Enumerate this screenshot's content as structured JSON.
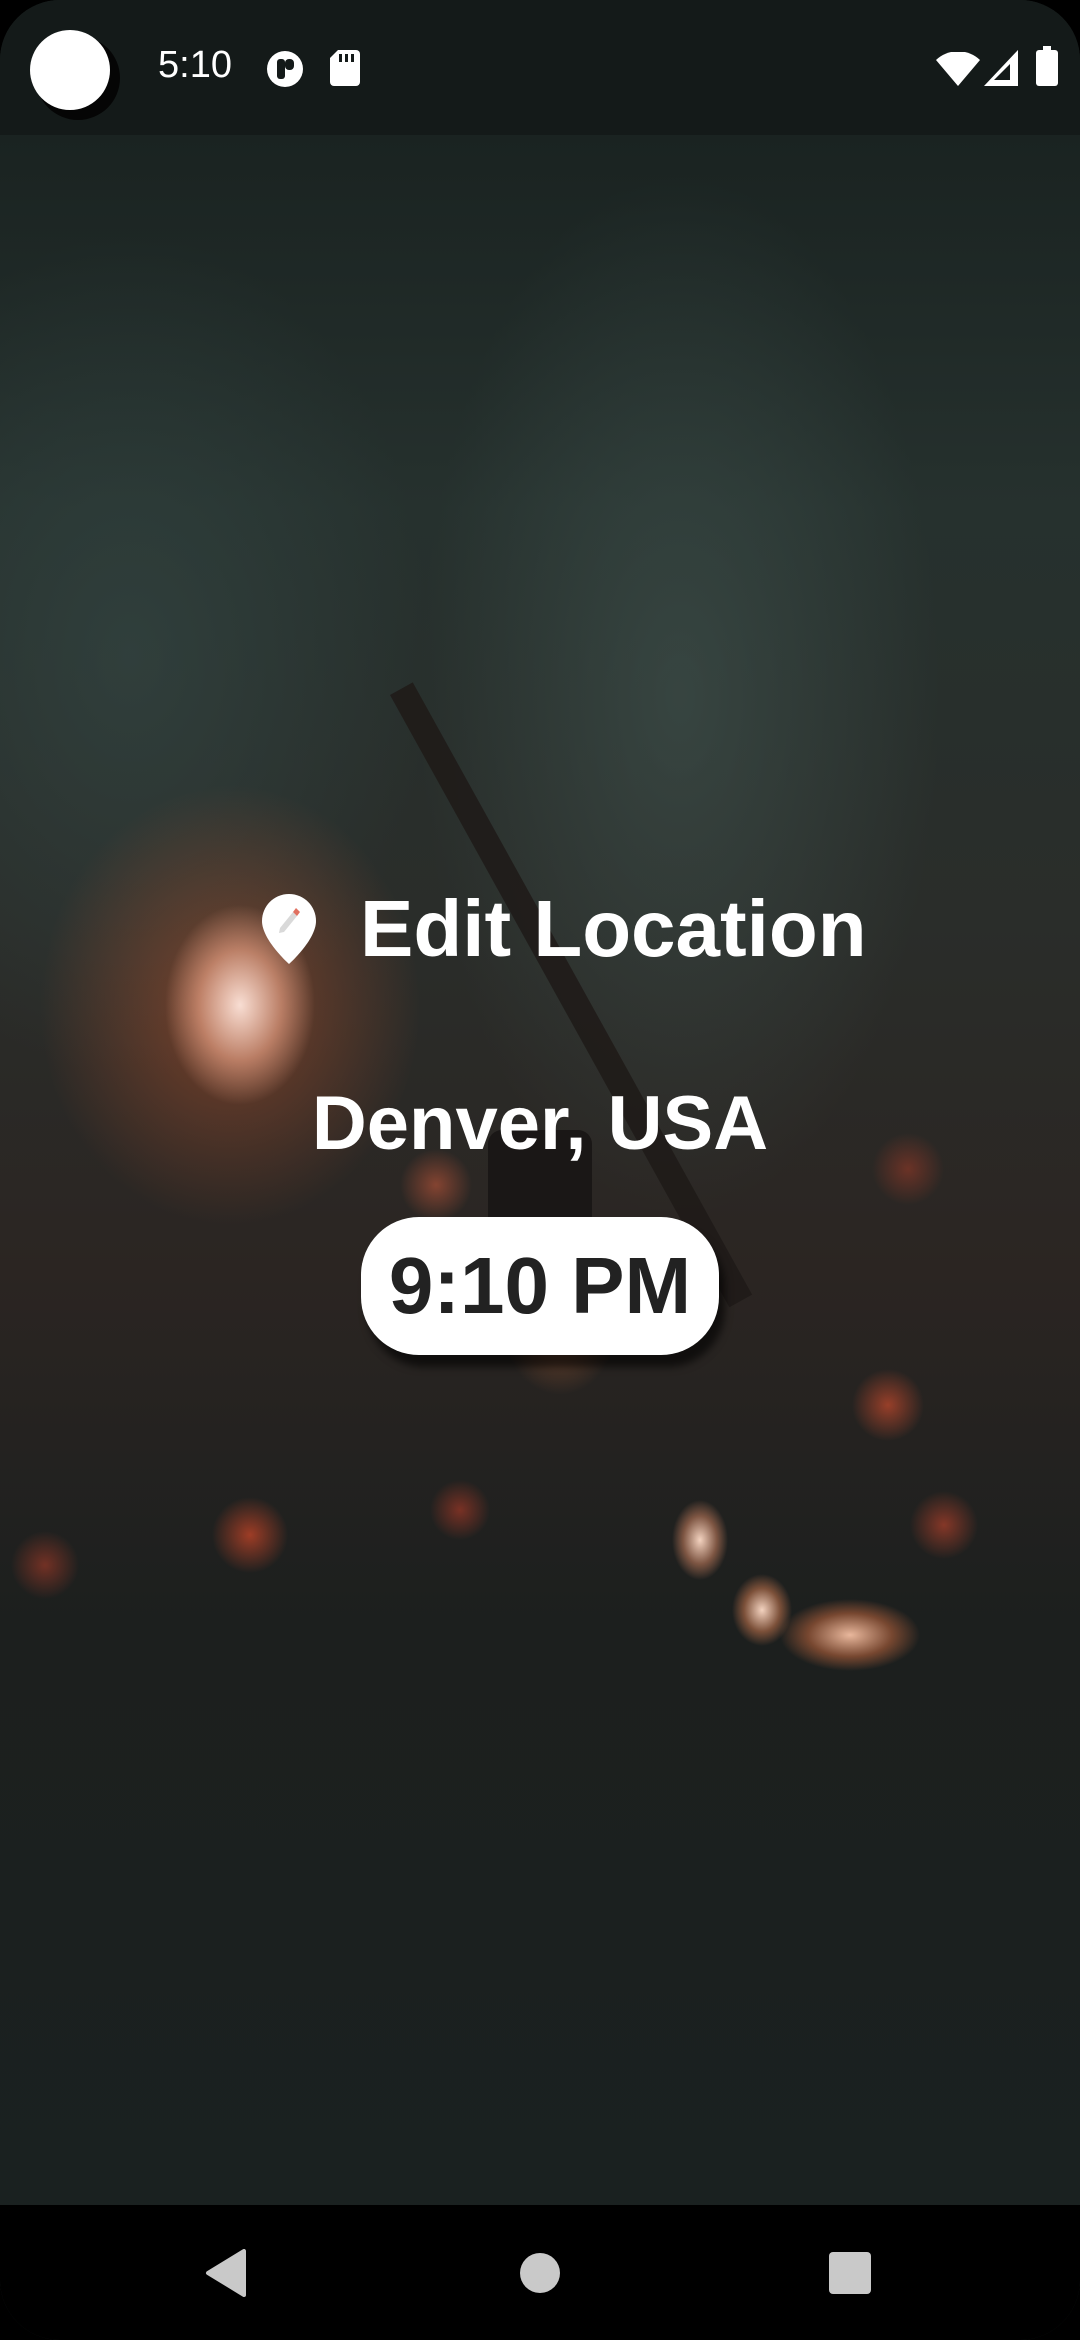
{
  "status_bar": {
    "time": "5:10",
    "left_icons": [
      "app-notification-icon",
      "sd-card-icon"
    ],
    "right_icons": [
      "wifi-icon",
      "cell-signal-icon",
      "battery-icon"
    ]
  },
  "main": {
    "edit_location_label": "Edit Location",
    "location_name": "Denver, USA",
    "time": "9:10 PM"
  },
  "nav_bar": {
    "buttons": [
      "back-icon",
      "home-icon",
      "recents-icon"
    ]
  },
  "colors": {
    "text": "#ffffff",
    "pill_background": "#ffffff",
    "pill_text": "#222222",
    "status_bar_background": "#141a19",
    "nav_bar_background": "#000000"
  }
}
